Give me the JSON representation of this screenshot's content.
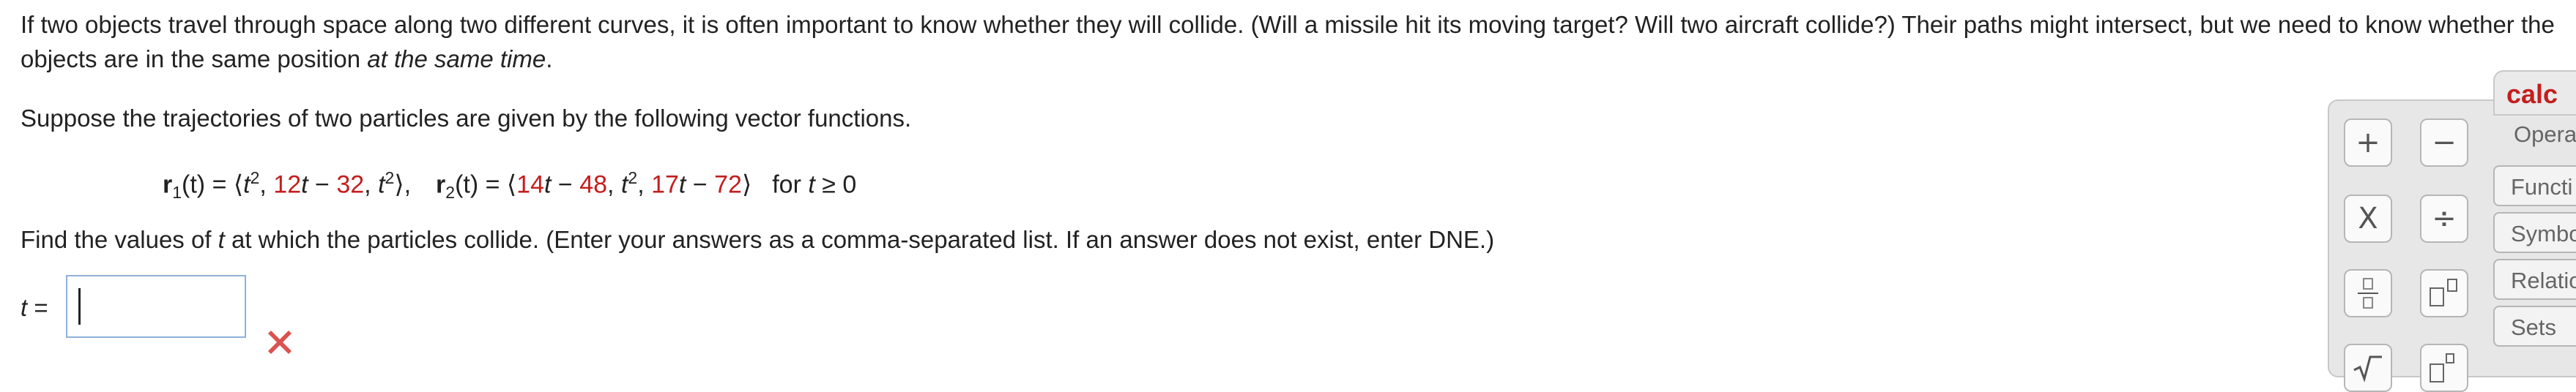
{
  "intro": {
    "text_before_italic": "If two objects travel through space along two different curves, it is often important to know whether they will collide. (Will a missile hit its moving target? Will two aircraft collide?) Their paths might intersect, but we need to know whether the objects are in the same position ",
    "italic_text": "at the same time",
    "text_end": "."
  },
  "setup_text": "Suppose the trajectories of two particles are given by the following vector functions.",
  "equation": {
    "r1_name": "r",
    "r1_sub": "1",
    "r1_arg": "(t) = ⟨",
    "r1_comp1": "t",
    "r1_comp1_exp": "2",
    "r1_sep1": ", ",
    "r1_comp2a": "12",
    "r1_comp2b": "t",
    "r1_comp2c": " − ",
    "r1_comp2d": "32",
    "r1_sep2": ", ",
    "r1_comp3": "t",
    "r1_comp3_exp": "2",
    "r1_close": "⟩,",
    "r2_name": "r",
    "r2_sub": "2",
    "r2_arg": "(t) = ⟨",
    "r2_comp1a": "14",
    "r2_comp1b": "t",
    "r2_comp1c": " − ",
    "r2_comp1d": "48",
    "r2_sep1": ", ",
    "r2_comp2": "t",
    "r2_comp2_exp": "2",
    "r2_sep2": ", ",
    "r2_comp3a": "17",
    "r2_comp3b": "t",
    "r2_comp3c": " − ",
    "r2_comp3d": "72",
    "r2_close": "⟩",
    "domain_text": "for ",
    "domain_var": "t",
    "domain_rel": " ≥ 0"
  },
  "question": {
    "before_var": "Find the values of ",
    "var": "t",
    "after_var": " at which the particles collide. (Enter your answers as a comma-separated list. If an answer does not exist, enter DNE.)"
  },
  "answer": {
    "label_var": "t",
    "label_eq": " =",
    "value": ""
  },
  "palette": {
    "title": "calc",
    "operations_label": "Opera",
    "tabs": [
      "Functi",
      "Symbo",
      "Relatio",
      "Sets"
    ],
    "buttons": {
      "plus": "+",
      "minus": "−",
      "times": "X",
      "divide": "÷"
    }
  },
  "colors": {
    "accent_red": "#c41e1e",
    "input_border": "#8fb0d8",
    "incorrect_mark": "#d9534f"
  }
}
